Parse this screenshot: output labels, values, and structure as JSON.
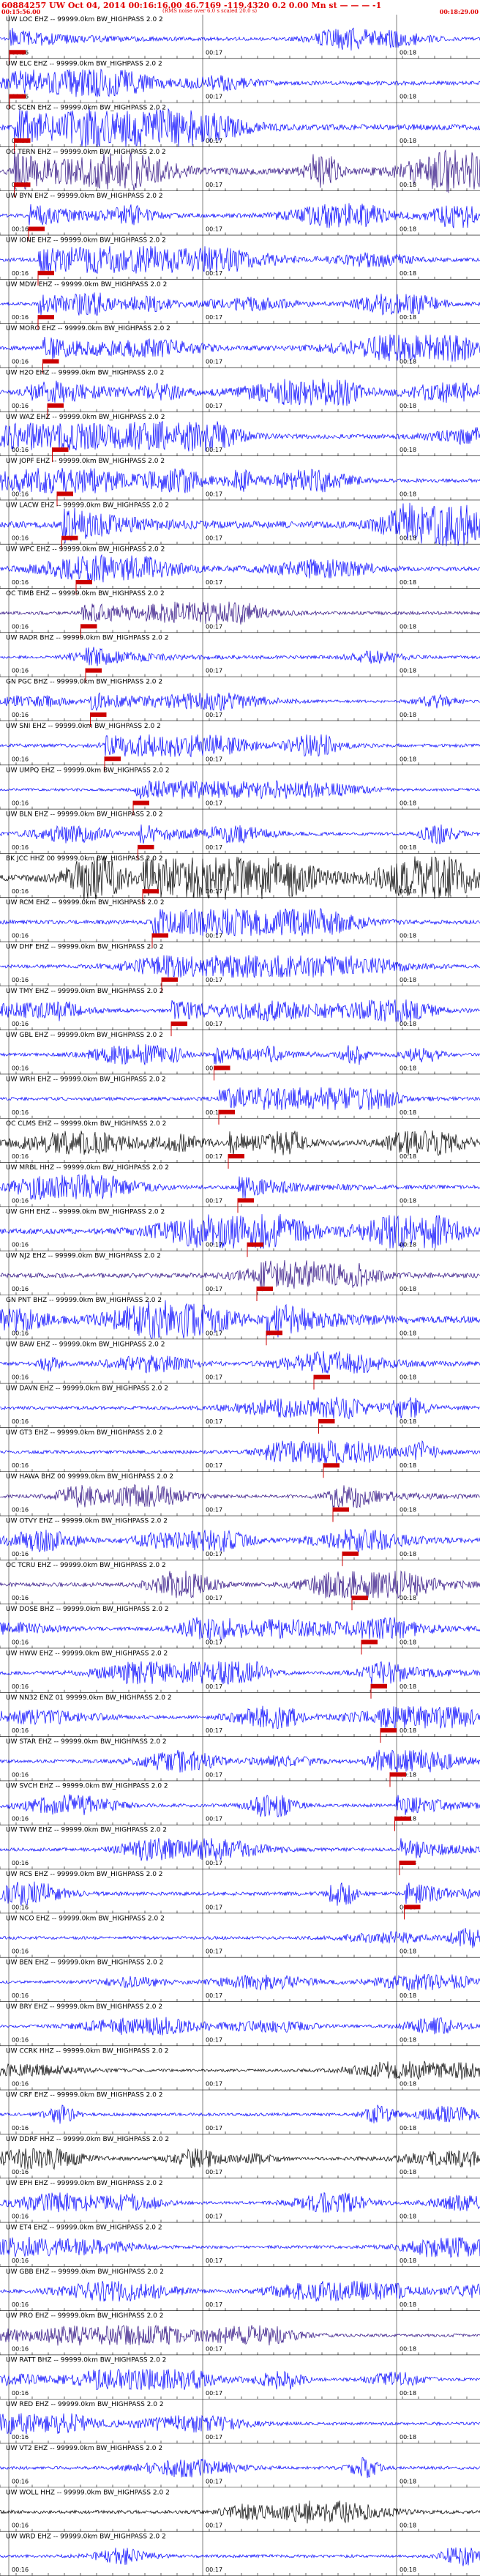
{
  "header": {
    "title": "60884257 UW Oct 04, 2014 00:16:16.00 46.7169 -119.4320 0.2 0.00 Mn st",
    "dashes": "— — — -1",
    "start_time": "00:15:56.00",
    "caption": "(RMS noise over 6.0 s scaled 20.0 s)",
    "end_time": "00:18:29.00"
  },
  "time_labels": [
    "00:16",
    "00:17",
    "00:18"
  ],
  "colors": {
    "blue": "#0000ff",
    "purple": "#2a0a80",
    "black": "#000000",
    "pick": "#cc0000"
  },
  "traces": [
    {
      "label": "UW LOC EHZ -- 99999.0km BW_HIGHPASS 2.0 2",
      "color": "#0000ff",
      "amp": 0.5,
      "pick": 0.02
    },
    {
      "label": "UW ELC EHZ -- 99999.0km BW_HIGHPASS 2.0 2",
      "color": "#0000ff",
      "amp": 0.6,
      "pick": 0.02
    },
    {
      "label": "OC SCEN EHZ -- 99999.0km BW_HIGHPASS 2.0 2",
      "color": "#0000ff",
      "amp": 0.85,
      "pick": 0.03
    },
    {
      "label": "OC TERN EHZ -- 99999.0km BW_HIGHPASS 2.0 2",
      "color": "#2a0a80",
      "amp": 0.95,
      "pick": 0.03
    },
    {
      "label": "UW BYN EHZ -- 99999.0km BW_HIGHPASS 2.0 2",
      "color": "#0000ff",
      "amp": 0.55,
      "pick": 0.06
    },
    {
      "label": "UW IONE EHZ -- 99999.0km BW_HIGHPASS 2.0 2",
      "color": "#0000ff",
      "amp": 0.6,
      "pick": 0.08
    },
    {
      "label": "UW MDW EHZ -- 99999.0km BW_HIGHPASS 2.0 2",
      "color": "#0000ff",
      "amp": 0.5,
      "pick": 0.08
    },
    {
      "label": "UW MORO EHZ -- 99999.0km BW_HIGHPASS 2.0 2",
      "color": "#0000ff",
      "amp": 0.6,
      "pick": 0.09
    },
    {
      "label": "UW H2O EHZ -- 99999.0km BW_HIGHPASS 2.0 2",
      "color": "#0000ff",
      "amp": 0.6,
      "pick": 0.1
    },
    {
      "label": "UW WAZ EHZ -- 99999.0km BW_HIGHPASS 2.0 2",
      "color": "#0000ff",
      "amp": 0.65,
      "pick": 0.11
    },
    {
      "label": "UW JOPF EHZ -- 99999.0km BW_HIGHPASS 2.0 2",
      "color": "#0000ff",
      "amp": 0.55,
      "pick": 0.12
    },
    {
      "label": "UW LACW EHZ -- 99999.0km BW_HIGHPASS 2.0 2",
      "color": "#0000ff",
      "amp": 0.95,
      "pick": 0.13
    },
    {
      "label": "UW WPC EHZ -- 99999.0km BW_HIGHPASS 2.0 2",
      "color": "#0000ff",
      "amp": 0.6,
      "pick": 0.16
    },
    {
      "label": "OC TIMB EHZ -- 99999.0km BW_HIGHPASS 2.0 2",
      "color": "#2a0a80",
      "amp": 0.5,
      "pick": 0.17
    },
    {
      "label": "UW RADR BHZ -- 99999.0km BW_HIGHPASS 2.0 2",
      "color": "#0000ff",
      "amp": 0.45,
      "pick": 0.18
    },
    {
      "label": "GN PGC BHZ -- 99999.0km BW_HIGHPASS 2.0 2",
      "color": "#0000ff",
      "amp": 0.4,
      "pick": 0.19
    },
    {
      "label": "UW SNI EHZ -- 99999.0km BW_HIGHPASS 2.0 2",
      "color": "#0000ff",
      "amp": 0.5,
      "pick": 0.22
    },
    {
      "label": "UW UMPQ EHZ -- 99999.0km BW_HIGHPASS 2.0 2",
      "color": "#0000ff",
      "amp": 0.4,
      "pick": 0.28
    },
    {
      "label": "UW BLN EHZ -- 99999.0km BW_HIGHPASS 2.0 2",
      "color": "#0000ff",
      "amp": 0.45,
      "pick": 0.29
    },
    {
      "label": "BK JCC HHZ 00 99999.0km BW_HIGHPASS 2.0 2",
      "color": "#000000",
      "amp": 0.95,
      "pick": 0.3
    },
    {
      "label": "UW RCM EHZ -- 99999.0km BW_HIGHPASS 2.0 2",
      "color": "#0000ff",
      "amp": 0.6,
      "pick": 0.32
    },
    {
      "label": "UW DHF EHZ -- 99999.0km BW_HIGHPASS 2.0 2",
      "color": "#0000ff",
      "amp": 0.5,
      "pick": 0.34
    },
    {
      "label": "UW TMY EHZ -- 99999.0km BW_HIGHPASS 2.0 2",
      "color": "#0000ff",
      "amp": 0.5,
      "pick": 0.36
    },
    {
      "label": "UW GBL EHZ -- 99999.0km BW_HIGHPASS 2.0 2",
      "color": "#0000ff",
      "amp": 0.45,
      "pick": 0.45
    },
    {
      "label": "UW WRH EHZ -- 99999.0km BW_HIGHPASS 2.0 2",
      "color": "#0000ff",
      "amp": 0.5,
      "pick": 0.46
    },
    {
      "label": "OC CLMS EHZ -- 99999.0km BW_HIGHPASS 2.0 2",
      "color": "#000000",
      "amp": 0.55,
      "pick": 0.48
    },
    {
      "label": "UW MRBL HHZ -- 99999.0km BW_HIGHPASS 2.0 2",
      "color": "#0000ff",
      "amp": 0.55,
      "pick": 0.5
    },
    {
      "label": "UW GHH EHZ -- 99999.0km BW_HIGHPASS 2.0 2",
      "color": "#0000ff",
      "amp": 0.75,
      "pick": 0.52
    },
    {
      "label": "UW NJ2 EHZ -- 99999.0km BW_HIGHPASS 2.0 2",
      "color": "#2a0a80",
      "amp": 0.7,
      "pick": 0.54
    },
    {
      "label": "GN PNT BHZ -- 99999.0km BW_HIGHPASS 2.0 2",
      "color": "#0000ff",
      "amp": 0.9,
      "pick": 0.56
    },
    {
      "label": "UW BAW EHZ -- 99999.0km BW_HIGHPASS 2.0 2",
      "color": "#0000ff",
      "amp": 0.55,
      "pick": 0.66
    },
    {
      "label": "UW DAVN EHZ -- 99999.0km BW_HIGHPASS 2.0 2",
      "color": "#0000ff",
      "amp": 0.5,
      "pick": 0.67
    },
    {
      "label": "UW GT3 EHZ -- 99999.0km BW_HIGHPASS 2.0 2",
      "color": "#0000ff",
      "amp": 0.5,
      "pick": 0.68
    },
    {
      "label": "UW HAWA BHZ 00 99999.0km BW_HIGHPASS 2.0 2",
      "color": "#2a0a80",
      "amp": 0.5,
      "pick": 0.7
    },
    {
      "label": "UW OTVY EHZ -- 99999.0km BW_HIGHPASS 2.0 2",
      "color": "#0000ff",
      "amp": 0.5,
      "pick": 0.72
    },
    {
      "label": "OC TCRU EHZ -- 99999.0km BW_HIGHPASS 2.0 2",
      "color": "#2a0a80",
      "amp": 0.6,
      "pick": 0.74
    },
    {
      "label": "UW DOSE BHZ -- 99999.0km BW_HIGHPASS 2.0 2",
      "color": "#0000ff",
      "amp": 0.5,
      "pick": 0.76
    },
    {
      "label": "UW HWW EHZ -- 99999.0km BW_HIGHPASS 2.0 2",
      "color": "#0000ff",
      "amp": 0.5,
      "pick": 0.78
    },
    {
      "label": "UW NN32 ENZ 01 99999.0km BW_HIGHPASS 2.0 2",
      "color": "#0000ff",
      "amp": 0.5,
      "pick": 0.8
    },
    {
      "label": "UW STAR EHZ -- 99999.0km BW_HIGHPASS 2.0 2",
      "color": "#0000ff",
      "amp": 0.5,
      "pick": 0.82
    },
    {
      "label": "UW SVCH EHZ -- 99999.0km BW_HIGHPASS 2.0 2",
      "color": "#0000ff",
      "amp": 0.5,
      "pick": 0.83
    },
    {
      "label": "UW TWW EHZ -- 99999.0km BW_HIGHPASS 2.0 2",
      "color": "#0000ff",
      "amp": 0.5,
      "pick": 0.84
    },
    {
      "label": "UW RCS EHZ -- 99999.0km BW_HIGHPASS 2.0 2",
      "color": "#0000ff",
      "amp": 0.55,
      "pick": 0.85
    },
    {
      "label": "UW NCO EHZ -- 99999.0km BW_HIGHPASS 2.0 2",
      "color": "#0000ff",
      "amp": 0.45,
      "pick": null
    },
    {
      "label": "UW BEN EHZ -- 99999.0km BW_HIGHPASS 2.0 2",
      "color": "#0000ff",
      "amp": 0.4,
      "pick": null
    },
    {
      "label": "UW BRY EHZ -- 99999.0km BW_HIGHPASS 2.0 2",
      "color": "#0000ff",
      "amp": 0.4,
      "pick": null
    },
    {
      "label": "UW CCRK HHZ -- 99999.0km BW_HIGHPASS 2.0 2",
      "color": "#000000",
      "amp": 0.4,
      "pick": null
    },
    {
      "label": "UW CRF EHZ -- 99999.0km BW_HIGHPASS 2.0 2",
      "color": "#0000ff",
      "amp": 0.45,
      "pick": null
    },
    {
      "label": "UW DDRF HHZ -- 99999.0km BW_HIGHPASS 2.0 2",
      "color": "#000000",
      "amp": 0.45,
      "pick": null
    },
    {
      "label": "UW EPH EHZ -- 99999.0km BW_HIGHPASS 2.0 2",
      "color": "#0000ff",
      "amp": 0.45,
      "pick": null
    },
    {
      "label": "UW ET4 EHZ -- 99999.0km BW_HIGHPASS 2.0 2",
      "color": "#0000ff",
      "amp": 0.45,
      "pick": null
    },
    {
      "label": "UW GBB EHZ -- 99999.0km BW_HIGHPASS 2.0 2",
      "color": "#0000ff",
      "amp": 0.45,
      "pick": null
    },
    {
      "label": "UW PRO EHZ -- 99999.0km BW_HIGHPASS 2.0 2",
      "color": "#2a0a80",
      "amp": 0.45,
      "pick": null
    },
    {
      "label": "UW RATT BHZ -- 99999.0km BW_HIGHPASS 2.0 2",
      "color": "#0000ff",
      "amp": 0.45,
      "pick": null
    },
    {
      "label": "UW RED EHZ -- 99999.0km BW_HIGHPASS 2.0 2",
      "color": "#0000ff",
      "amp": 0.45,
      "pick": null
    },
    {
      "label": "UW VT2 EHZ -- 99999.0km BW_HIGHPASS 2.0 2",
      "color": "#0000ff",
      "amp": 0.45,
      "pick": null
    },
    {
      "label": "UW WOLL HHZ -- 99999.0km BW_HIGHPASS 2.0 2",
      "color": "#000000",
      "amp": 0.5,
      "pick": null
    },
    {
      "label": "UW WRD EHZ -- 99999.0km BW_HIGHPASS 2.0 2",
      "color": "#0000ff",
      "amp": 0.45,
      "pick": null
    }
  ]
}
